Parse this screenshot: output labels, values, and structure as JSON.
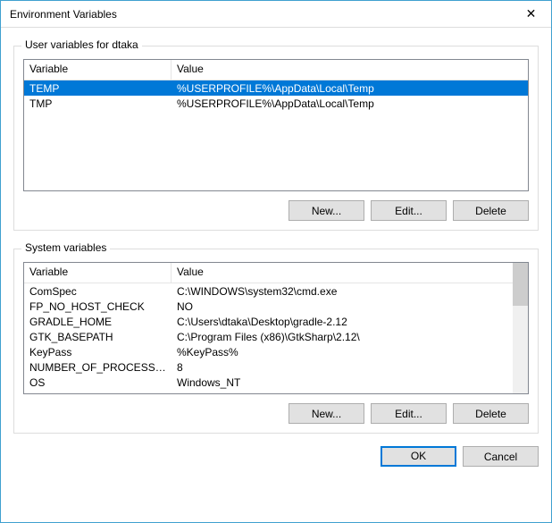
{
  "window": {
    "title": "Environment Variables",
    "close_icon": "✕"
  },
  "userGroup": {
    "label": "User variables for dtaka",
    "columns": {
      "variable": "Variable",
      "value": "Value"
    },
    "rows": [
      {
        "variable": "TEMP",
        "value": "%USERPROFILE%\\AppData\\Local\\Temp",
        "selected": true
      },
      {
        "variable": "TMP",
        "value": "%USERPROFILE%\\AppData\\Local\\Temp",
        "selected": false
      }
    ],
    "buttons": {
      "new": "New...",
      "edit": "Edit...",
      "delete": "Delete"
    }
  },
  "systemGroup": {
    "label": "System variables",
    "columns": {
      "variable": "Variable",
      "value": "Value"
    },
    "rows": [
      {
        "variable": "ComSpec",
        "value": "C:\\WINDOWS\\system32\\cmd.exe",
        "selected": true
      },
      {
        "variable": "FP_NO_HOST_CHECK",
        "value": "NO"
      },
      {
        "variable": "GRADLE_HOME",
        "value": "C:\\Users\\dtaka\\Desktop\\gradle-2.12"
      },
      {
        "variable": "GTK_BASEPATH",
        "value": "C:\\Program Files (x86)\\GtkSharp\\2.12\\"
      },
      {
        "variable": "KeyPass",
        "value": "%KeyPass%"
      },
      {
        "variable": "NUMBER_OF_PROCESSORS",
        "value": "8"
      },
      {
        "variable": "OS",
        "value": "Windows_NT"
      }
    ],
    "buttons": {
      "new": "New...",
      "edit": "Edit...",
      "delete": "Delete"
    }
  },
  "dialog": {
    "ok": "OK",
    "cancel": "Cancel"
  }
}
